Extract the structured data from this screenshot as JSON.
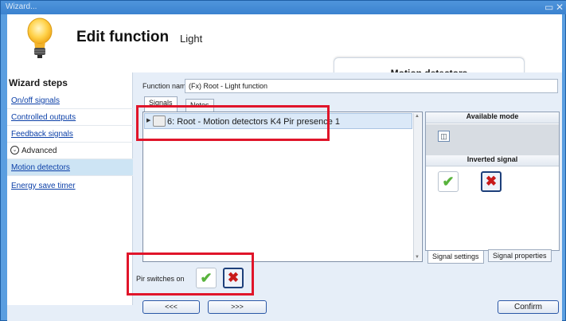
{
  "window": {
    "title": "Wizard..."
  },
  "header": {
    "title": "Edit function",
    "subtitle": "Light",
    "tab_label": "Motion detectors"
  },
  "wizard": {
    "heading": "Wizard steps",
    "items": [
      {
        "label": "On/off signals"
      },
      {
        "label": "Controlled outputs"
      },
      {
        "label": "Feedback signals"
      },
      {
        "label": "Advanced"
      },
      {
        "label": "Motion detectors"
      },
      {
        "label": "Energy save timer"
      }
    ]
  },
  "function_name": {
    "label": "Function name:",
    "value": "(Fx) Root - Light function"
  },
  "tabs": [
    {
      "label": "Signals"
    },
    {
      "label": "Notes"
    }
  ],
  "signals": [
    {
      "label": "6: Root - Motion detectors K4 Pir presence 1"
    }
  ],
  "available_mode": {
    "heading": "Available mode"
  },
  "inverted_signal": {
    "heading": "Inverted signal"
  },
  "right_tabs": [
    {
      "label": "Signal settings"
    },
    {
      "label": "Signal properties"
    }
  ],
  "pir": {
    "label": "Pir switches on"
  },
  "nav": {
    "prev": "<<<",
    "next": ">>>",
    "confirm": "Confirm"
  },
  "colors": {
    "highlight": "#e0152a",
    "accent": "#2f7fd1",
    "ok_green": "#58b33c",
    "cancel_red": "#c81a1a"
  },
  "icons": {
    "bulb": "light-bulb-icon",
    "ok": "check-icon",
    "cancel": "cross-icon",
    "mode": "mode-icon"
  }
}
